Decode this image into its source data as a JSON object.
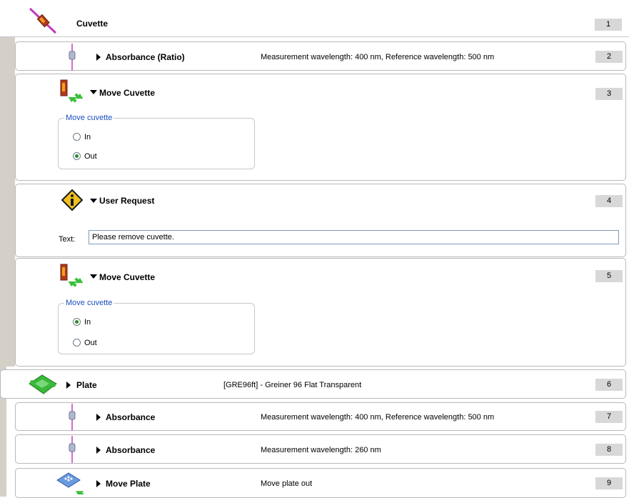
{
  "steps": {
    "s1": {
      "title": "Cuvette",
      "number": "1"
    },
    "s2": {
      "title": "Absorbance (Ratio)",
      "description": "Measurement wavelength: 400 nm, Reference wavelength: 500 nm",
      "number": "2"
    },
    "s3": {
      "title": "Move Cuvette",
      "number": "3",
      "group_label": "Move cuvette",
      "opt_in": "In",
      "opt_out": "Out",
      "selected": "Out"
    },
    "s4": {
      "title": "User Request",
      "number": "4",
      "text_label": "Text:",
      "text_value": "Please remove cuvette."
    },
    "s5": {
      "title": "Move Cuvette",
      "number": "5",
      "group_label": "Move cuvette",
      "opt_in": "In",
      "opt_out": "Out",
      "selected": "In"
    },
    "s6": {
      "title": "Plate",
      "description": "[GRE96ft] - Greiner 96 Flat Transparent",
      "number": "6"
    },
    "s7": {
      "title": "Absorbance",
      "description": "Measurement wavelength: 400 nm, Reference wavelength: 500 nm",
      "number": "7"
    },
    "s8": {
      "title": "Absorbance",
      "description": "Measurement wavelength: 260 nm",
      "number": "8"
    },
    "s9": {
      "title": "Move Plate",
      "description": "Move plate out",
      "number": "9"
    }
  },
  "icons": {
    "cuvette": "cuvette-icon",
    "absorbance": "absorbance-probe-icon",
    "move_cuvette": "move-cuvette-icon",
    "user_request": "info-warning-icon",
    "plate": "plate-icon",
    "move_plate": "move-plate-icon"
  },
  "colors": {
    "group_label": "#1c4fc0",
    "step_number_bg": "#d8d8d8",
    "gutter": "#d4d0c8"
  }
}
